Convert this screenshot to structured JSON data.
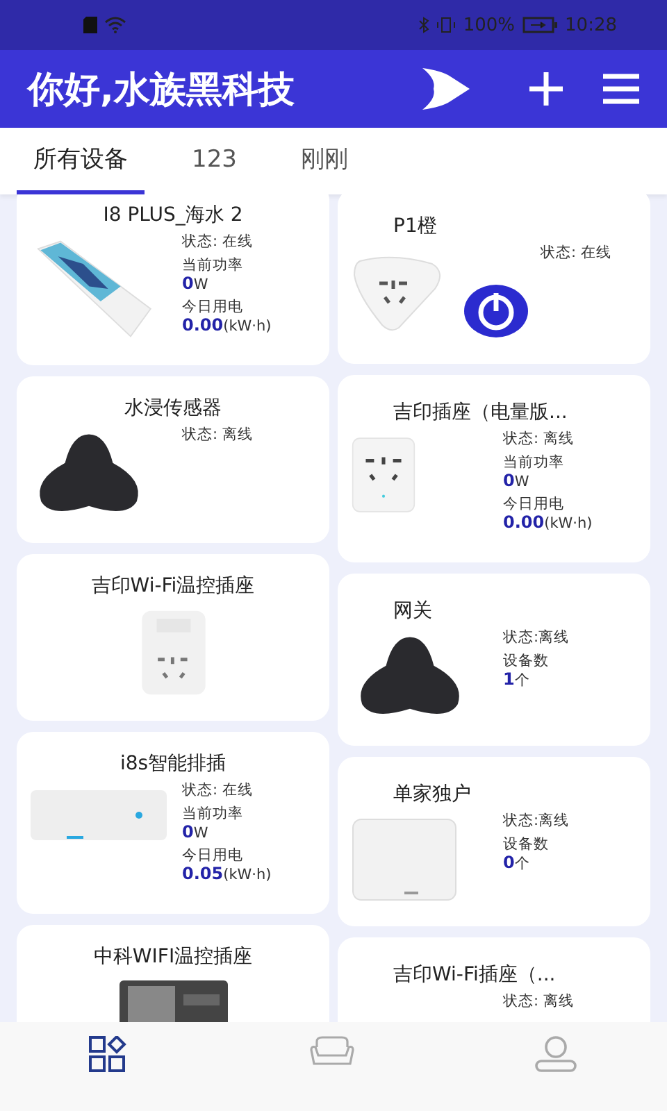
{
  "status_bar": {
    "battery": "100%",
    "time": "10:28"
  },
  "header": {
    "title": "你好,水族黑科技"
  },
  "tabs": [
    {
      "label": "所有设备",
      "selected": true
    },
    {
      "label": "123",
      "selected": false
    },
    {
      "label": "刚刚",
      "selected": false
    }
  ],
  "device_columns": [
    {
      "devices": [
        {
          "name": "I8 PLUS_海水 2",
          "kind": "light_bar",
          "stats": [
            {
              "kind": "status",
              "text": "状态: 在线"
            },
            {
              "kind": "metric",
              "label": "当前功率",
              "value": "0",
              "unit": "W"
            },
            {
              "kind": "metric",
              "label": "今日用电",
              "value": "0.00",
              "unit": "(kW·h)"
            }
          ]
        },
        {
          "name": "水浸传感器",
          "kind": "dark_puck",
          "stats": [
            {
              "kind": "status",
              "text": "状态: 离线"
            }
          ]
        },
        {
          "name": "吉印Wi-Fi温控插座",
          "kind": "thermo_plug"
        },
        {
          "name": "i8s智能排插",
          "kind": "power_strip",
          "stats": [
            {
              "kind": "status",
              "text": "状态: 在线"
            },
            {
              "kind": "metric",
              "label": "当前功率",
              "value": "0",
              "unit": "W"
            },
            {
              "kind": "metric",
              "label": "今日用电",
              "value": "0.05",
              "unit": "(kW·h)"
            }
          ]
        },
        {
          "name": "中科WIFI温控插座",
          "kind": "dark_plug"
        }
      ]
    },
    {
      "devices": [
        {
          "name": "P1橙",
          "kind": "triangle_plug",
          "power": {
            "on": true
          },
          "stats": [
            {
              "kind": "status",
              "text": "状态: 在线"
            }
          ]
        },
        {
          "name": "吉印插座（电量版...",
          "kind": "square_plug",
          "stats": [
            {
              "kind": "status",
              "text": "状态: 离线"
            },
            {
              "kind": "metric",
              "label": "当前功率",
              "value": "0",
              "unit": "W"
            },
            {
              "kind": "metric",
              "label": "今日用电",
              "value": "0.00",
              "unit": "(kW·h)"
            }
          ]
        },
        {
          "name": "网关",
          "kind": "dark_puck",
          "stats": [
            {
              "kind": "status",
              "text": "状态:离线"
            },
            {
              "kind": "metric",
              "label": "设备数",
              "value": "1",
              "unit": "个"
            }
          ]
        },
        {
          "name": "单家独户",
          "kind": "hub_box",
          "stats": [
            {
              "kind": "status",
              "text": "状态:离线"
            },
            {
              "kind": "metric",
              "label": "设备数",
              "value": "0",
              "unit": "个"
            }
          ]
        },
        {
          "name": "吉印Wi-Fi插座（...",
          "stats": [
            {
              "kind": "status",
              "text": "状态: 离线"
            }
          ]
        }
      ]
    }
  ],
  "bottom_nav": [
    {
      "selected": true
    },
    {
      "selected": false
    },
    {
      "selected": false
    }
  ]
}
